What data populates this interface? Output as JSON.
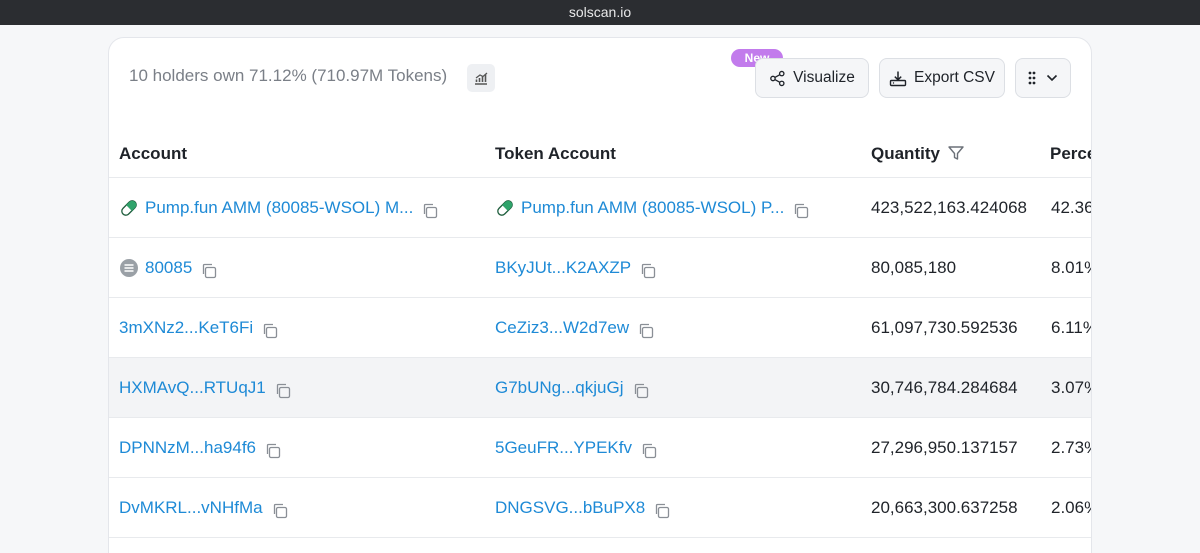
{
  "browser": {
    "url_title": "solscan.io"
  },
  "summary": {
    "text": "10 holders own 71.12% (710.97M Tokens)"
  },
  "actions": {
    "new_badge": "New",
    "visualize_label": "Visualize",
    "export_label": "Export CSV"
  },
  "columns": {
    "account": "Account",
    "token_account": "Token Account",
    "quantity": "Quantity",
    "percentage": "Perce"
  },
  "rows": [
    {
      "account": "Pump.fun AMM (80085-WSOL) M...",
      "token_account": "Pump.fun AMM (80085-WSOL) P...",
      "quantity": "423,522,163.424068",
      "percentage": "42.36"
    },
    {
      "account": "80085",
      "token_account": "BKyJUt...K2AXZP",
      "quantity": "80,085,180",
      "percentage": "8.01%"
    },
    {
      "account": "3mXNz2...KeT6Fi",
      "token_account": "CeZiz3...W2d7ew",
      "quantity": "61,097,730.592536",
      "percentage": "6.11%"
    },
    {
      "account": "HXMAvQ...RTUqJ1",
      "token_account": "G7bUNg...qkjuGj",
      "quantity": "30,746,784.284684",
      "percentage": "3.07%"
    },
    {
      "account": "DPNNzM...ha94f6",
      "token_account": "5GeuFR...YPEKfv",
      "quantity": "27,296,950.137157",
      "percentage": "2.73%"
    },
    {
      "account": "DvMKRL...vNHfMa",
      "token_account": "DNGSVG...bBuPX8",
      "quantity": "20,663,300.637258",
      "percentage": "2.06%"
    }
  ],
  "colors": {
    "link": "#1e8ad6",
    "new_badge": "#c27bec",
    "pill_green": "#2fa36b",
    "highlight_row": "#f3f4f6"
  },
  "icons": [
    "chart-icon",
    "share-icon",
    "download-icon",
    "grid-icon",
    "chevron-down-icon",
    "filter-icon",
    "copy-icon",
    "pill-icon",
    "coin-icon"
  ]
}
